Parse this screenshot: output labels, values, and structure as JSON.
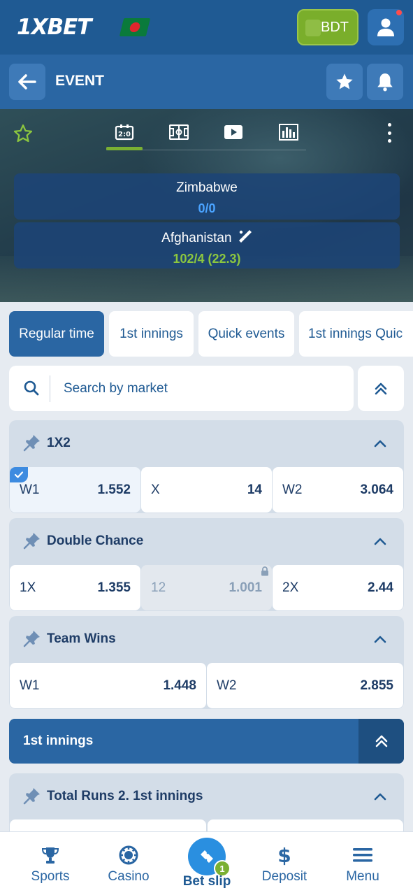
{
  "header": {
    "logo": "1XBET",
    "currency": "BDT"
  },
  "event_bar": {
    "title": "EVENT"
  },
  "scoreboard": {
    "team1": {
      "name": "Zimbabwe",
      "score": "0/0",
      "score_color": "#4aa3ff"
    },
    "team2": {
      "name": "Afghanistan",
      "score": "102/4 (22.3)",
      "score_color": "#8cc63f"
    }
  },
  "filters": [
    {
      "label": "Regular time",
      "active": true
    },
    {
      "label": "1st innings",
      "active": false
    },
    {
      "label": "Quick events",
      "active": false
    },
    {
      "label": "1st innings Quic",
      "active": false
    }
  ],
  "search": {
    "placeholder": "Search by market"
  },
  "markets": [
    {
      "title": "1X2",
      "odds": [
        {
          "label": "W1",
          "value": "1.552",
          "selected": true
        },
        {
          "label": "X",
          "value": "14"
        },
        {
          "label": "W2",
          "value": "3.064"
        }
      ]
    },
    {
      "title": "Double Chance",
      "odds": [
        {
          "label": "1X",
          "value": "1.355"
        },
        {
          "label": "12",
          "value": "1.001",
          "locked": true
        },
        {
          "label": "2X",
          "value": "2.44"
        }
      ]
    },
    {
      "title": "Team Wins",
      "odds": [
        {
          "label": "W1",
          "value": "1.448"
        },
        {
          "label": "W2",
          "value": "2.855"
        }
      ]
    }
  ],
  "section": {
    "title": "1st innings"
  },
  "next_market": {
    "title": "Total Runs 2. 1st innings"
  },
  "bottom_nav": {
    "sports": "Sports",
    "casino": "Casino",
    "betslip": "Bet slip",
    "betslip_count": "1",
    "deposit": "Deposit",
    "menu": "Menu"
  },
  "colors": {
    "brand_dark": "#1f5a93",
    "brand": "#2a66a3",
    "accent_green": "#7ab033"
  }
}
